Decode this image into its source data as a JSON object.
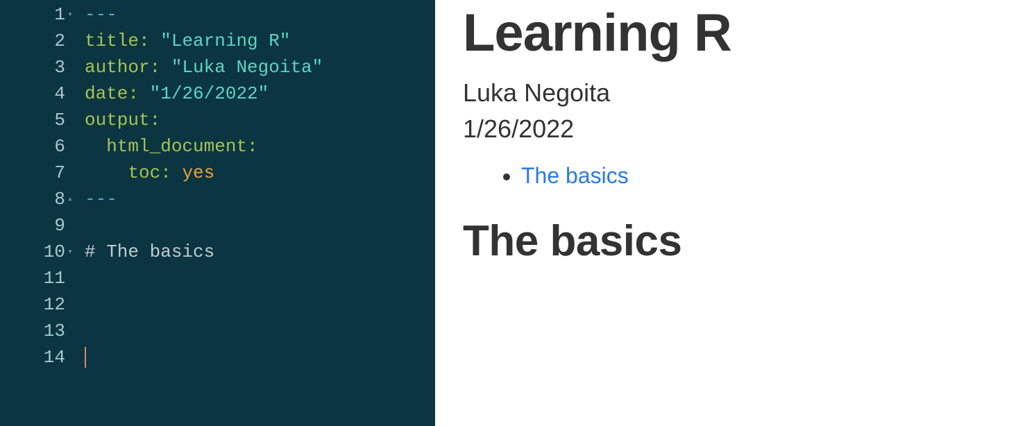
{
  "editor": {
    "lines": [
      {
        "num": "1",
        "fold": "down",
        "tokens": [
          {
            "cls": "tok-delim",
            "text": "---"
          }
        ]
      },
      {
        "num": "2",
        "fold": "",
        "tokens": [
          {
            "cls": "tok-key",
            "text": "title:"
          },
          {
            "cls": "",
            "text": " "
          },
          {
            "cls": "tok-string",
            "text": "\"Learning R\""
          }
        ]
      },
      {
        "num": "3",
        "fold": "",
        "tokens": [
          {
            "cls": "tok-key",
            "text": "author:"
          },
          {
            "cls": "",
            "text": " "
          },
          {
            "cls": "tok-string",
            "text": "\"Luka Negoita\""
          }
        ]
      },
      {
        "num": "4",
        "fold": "",
        "tokens": [
          {
            "cls": "tok-key",
            "text": "date:"
          },
          {
            "cls": "",
            "text": " "
          },
          {
            "cls": "tok-string",
            "text": "\"1/26/2022\""
          }
        ]
      },
      {
        "num": "5",
        "fold": "",
        "tokens": [
          {
            "cls": "tok-key",
            "text": "output:"
          }
        ]
      },
      {
        "num": "6",
        "fold": "",
        "tokens": [
          {
            "cls": "",
            "text": "  "
          },
          {
            "cls": "tok-key",
            "text": "html_document:"
          }
        ]
      },
      {
        "num": "7",
        "fold": "",
        "tokens": [
          {
            "cls": "",
            "text": "    "
          },
          {
            "cls": "tok-key",
            "text": "toc:"
          },
          {
            "cls": "",
            "text": " "
          },
          {
            "cls": "tok-value",
            "text": "yes"
          }
        ]
      },
      {
        "num": "8",
        "fold": "up",
        "tokens": [
          {
            "cls": "tok-delim",
            "text": "---"
          }
        ]
      },
      {
        "num": "9",
        "fold": "",
        "tokens": []
      },
      {
        "num": "10",
        "fold": "down",
        "tokens": [
          {
            "cls": "tok-heading",
            "text": "# The basics"
          }
        ]
      },
      {
        "num": "11",
        "fold": "",
        "tokens": []
      },
      {
        "num": "12",
        "fold": "",
        "tokens": []
      },
      {
        "num": "13",
        "fold": "",
        "tokens": []
      },
      {
        "num": "14",
        "fold": "",
        "tokens": [],
        "cursor": true
      }
    ]
  },
  "preview": {
    "title": "Learning R",
    "author": "Luka Negoita",
    "date": "1/26/2022",
    "toc": [
      {
        "label": "The basics"
      }
    ],
    "headings": [
      {
        "text": "The basics"
      }
    ]
  }
}
